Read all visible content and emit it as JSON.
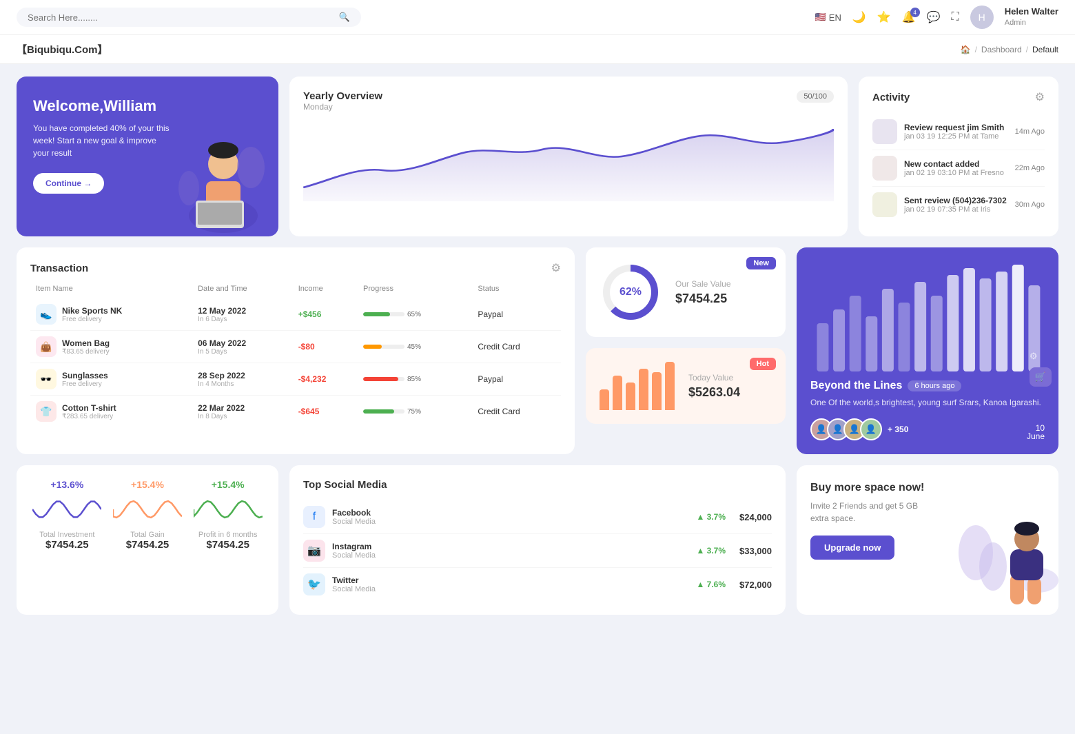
{
  "topnav": {
    "search_placeholder": "Search Here........",
    "lang": "EN",
    "notification_count": "4",
    "user_name": "Helen Walter",
    "user_role": "Admin"
  },
  "breadcrumb": {
    "brand": "【Biqubiqu.Com】",
    "home": "🏠",
    "dashboard": "Dashboard",
    "default": "Default"
  },
  "welcome": {
    "title": "Welcome,William",
    "subtitle": "You have completed 40% of your this week! Start a new goal & improve your result",
    "button": "Continue →"
  },
  "yearly": {
    "title": "Yearly Overview",
    "day": "Monday",
    "progress": "50/100"
  },
  "activity": {
    "title": "Activity",
    "items": [
      {
        "title": "Review request jim Smith",
        "sub": "jan 03 19 12:25 PM at Tame",
        "time": "14m Ago"
      },
      {
        "title": "New contact added",
        "sub": "jan 02 19 03:10 PM at Fresno",
        "time": "22m Ago"
      },
      {
        "title": "Sent review (504)236-7302",
        "sub": "jan 02 19 07:35 PM at Iris",
        "time": "30m Ago"
      }
    ]
  },
  "transaction": {
    "title": "Transaction",
    "headers": [
      "Item Name",
      "Date and Time",
      "Income",
      "Progress",
      "Status"
    ],
    "rows": [
      {
        "icon": "👟",
        "icon_bg": "#e8f4fd",
        "name": "Nike Sports NK",
        "sub": "Free delivery",
        "date": "12 May 2022",
        "days": "In 6 Days",
        "income": "+$456",
        "income_type": "pos",
        "progress": 65,
        "progress_color": "#4caf50",
        "status": "Paypal"
      },
      {
        "icon": "👜",
        "icon_bg": "#fde8f0",
        "name": "Women Bag",
        "sub": "₹83.65 delivery",
        "date": "06 May 2022",
        "days": "In 5 Days",
        "income": "-$80",
        "income_type": "neg",
        "progress": 45,
        "progress_color": "#ff9800",
        "status": "Credit Card"
      },
      {
        "icon": "🕶️",
        "icon_bg": "#fff8e0",
        "name": "Sunglasses",
        "sub": "Free delivery",
        "date": "28 Sep 2022",
        "days": "In 4 Months",
        "income": "-$4,232",
        "income_type": "neg",
        "progress": 85,
        "progress_color": "#f44336",
        "status": "Paypal"
      },
      {
        "icon": "👕",
        "icon_bg": "#fde8e8",
        "name": "Cotton T-shirt",
        "sub": "₹283.65 delivery",
        "date": "22 Mar 2022",
        "days": "In 8 Days",
        "income": "-$645",
        "income_type": "neg",
        "progress": 75,
        "progress_color": "#4caf50",
        "status": "Credit Card"
      }
    ]
  },
  "sale": {
    "badge": "New",
    "percent": "62%",
    "title": "Our Sale Value",
    "value": "$7454.25"
  },
  "today": {
    "badge": "Hot",
    "title": "Today Value",
    "value": "$5263.04",
    "bars": [
      30,
      50,
      40,
      60,
      55,
      70
    ]
  },
  "beyond": {
    "title": "Beyond the Lines",
    "time": "6 hours ago",
    "desc": "One Of the world,s brightest, young surf Srars, Kanoa Igarashi.",
    "extra": "+ 350",
    "date": "10",
    "month": "June"
  },
  "mini_charts": {
    "items": [
      {
        "percent": "+13.6%",
        "label": "Total Investment",
        "value": "$7454.25",
        "color": "#5b4fcf"
      },
      {
        "percent": "+15.4%",
        "label": "Total Gain",
        "value": "$7454.25",
        "color": "#ff9966"
      },
      {
        "percent": "+15.4%",
        "label": "Profit in 6 months",
        "value": "$7454.25",
        "color": "#4caf50"
      }
    ]
  },
  "social": {
    "title": "Top Social Media",
    "items": [
      {
        "name": "Facebook",
        "type": "Social Media",
        "grow": "3.7%",
        "amount": "$24,000",
        "color": "#1877f2",
        "icon": "f"
      },
      {
        "name": "Instagram",
        "type": "Social Media",
        "grow": "3.7%",
        "amount": "$33,000",
        "color": "#e1306c",
        "icon": "📷"
      },
      {
        "name": "Twitter",
        "type": "Social Media",
        "grow": "7.6%",
        "amount": "$72,000",
        "color": "#1da1f2",
        "icon": "🐦"
      }
    ]
  },
  "buy": {
    "title": "Buy more space now!",
    "desc": "Invite 2 Friends and get 5 GB extra space.",
    "button": "Upgrade now"
  }
}
